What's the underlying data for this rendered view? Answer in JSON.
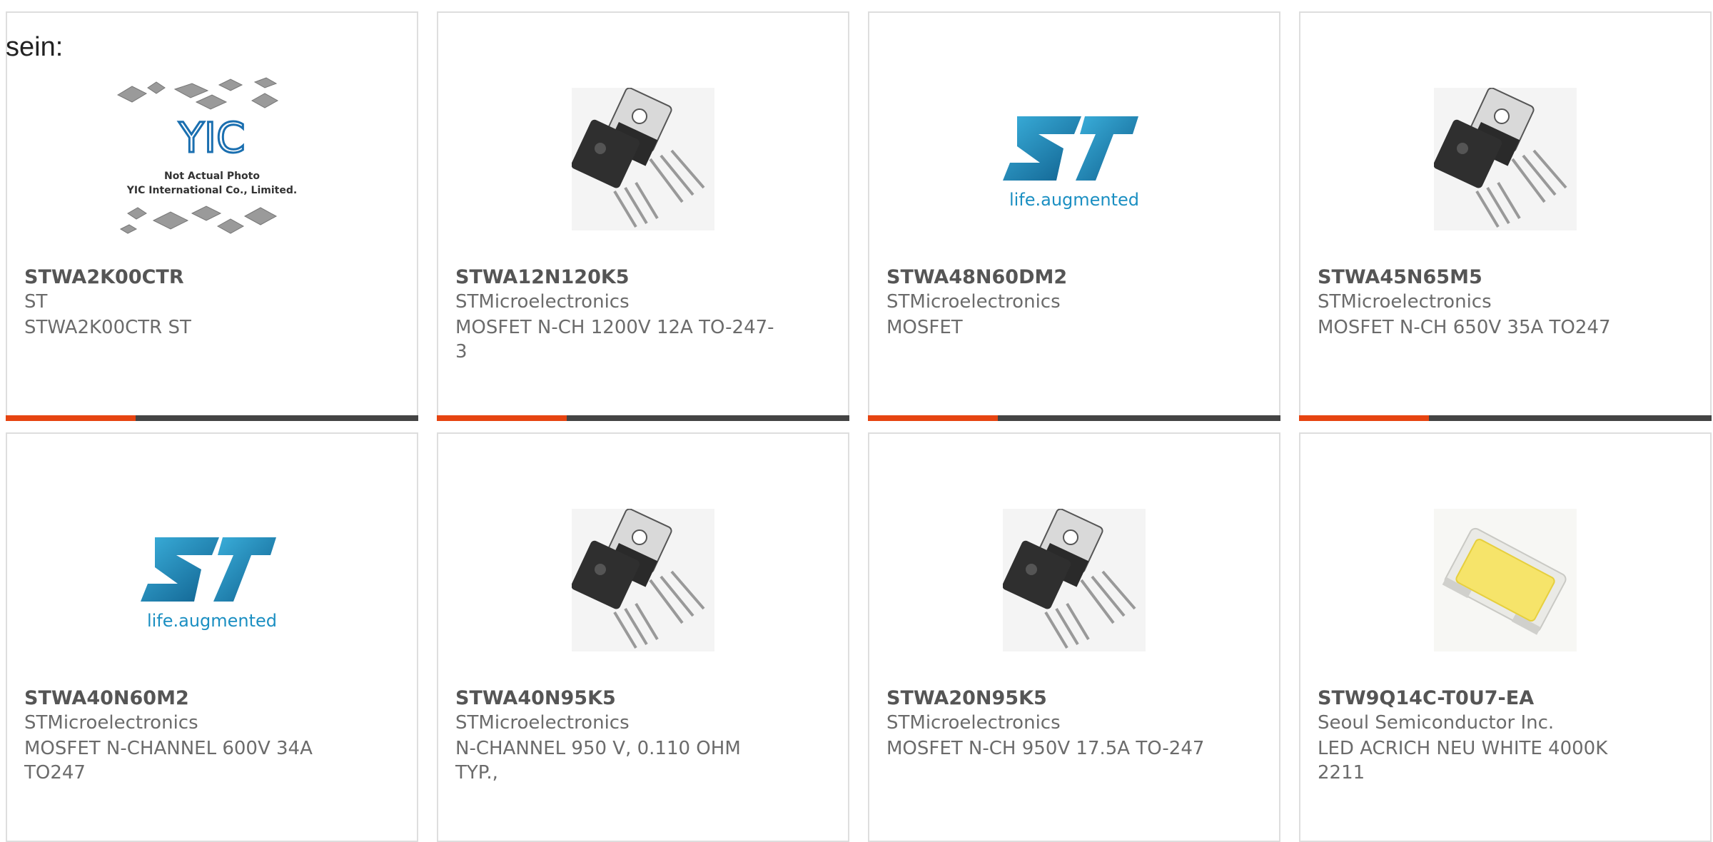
{
  "intro_text": "sein:",
  "colors": {
    "accent": "#e64411",
    "bar": "#444444",
    "st_blue": "#1b8fc2"
  },
  "products": [
    {
      "part": "STWA2K00CTR",
      "manufacturer": "ST",
      "description": "STWA2K00CTR ST",
      "image": "generic-ic-photo",
      "image_text": [
        "Not Actual Photo",
        "YIC International Co., Limited.",
        "YIC"
      ]
    },
    {
      "part": "STWA12N120K5",
      "manufacturer": "STMicroelectronics",
      "description": "MOSFET N-CH 1200V 12A TO-247-3",
      "image": "to247-transistor"
    },
    {
      "part": "STWA48N60DM2",
      "manufacturer": "STMicroelectronics",
      "description": "MOSFET",
      "image": "st-logo",
      "image_text": [
        "life.augmented"
      ]
    },
    {
      "part": "STWA45N65M5",
      "manufacturer": "STMicroelectronics",
      "description": "MOSFET N-CH 650V 35A TO247",
      "image": "to247-transistor"
    },
    {
      "part": "STWA40N60M2",
      "manufacturer": "STMicroelectronics",
      "description": "MOSFET N-CHANNEL 600V 34A TO247",
      "image": "st-logo",
      "image_text": [
        "life.augmented"
      ]
    },
    {
      "part": "STWA40N95K5",
      "manufacturer": "STMicroelectronics",
      "description": "N-CHANNEL 950 V, 0.110 OHM TYP.,",
      "image": "to247-transistor"
    },
    {
      "part": "STWA20N95K5",
      "manufacturer": "STMicroelectronics",
      "description": "MOSFET N-CH 950V 17.5A TO-247",
      "image": "to247-transistor"
    },
    {
      "part": "STW9Q14C-T0U7-EA",
      "manufacturer": "Seoul Semiconductor Inc.",
      "description": "LED ACRICH NEU WHITE 4000K 2211",
      "image": "led-package"
    }
  ]
}
